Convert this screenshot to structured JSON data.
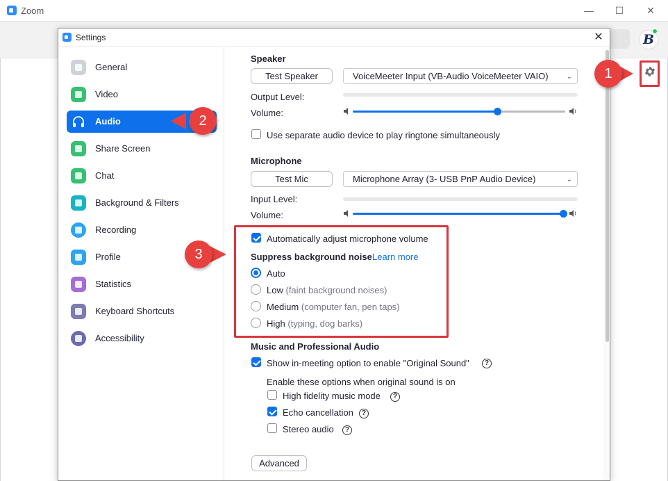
{
  "app": {
    "title": "Zoom",
    "minimize": "—",
    "maximize": "☐",
    "close": "✕",
    "avatar_letter": "B"
  },
  "callouts": [
    "1",
    "2",
    "3"
  ],
  "dialog": {
    "title": "Settings",
    "close": "✕"
  },
  "sidebar": {
    "items": [
      {
        "label": "General",
        "icon": "gear-icon",
        "color": "#cfd3d8"
      },
      {
        "label": "Video",
        "icon": "video-icon",
        "color": "#36c172"
      },
      {
        "label": "Audio",
        "icon": "headphones-icon",
        "color": "#0e71eb"
      },
      {
        "label": "Share Screen",
        "icon": "share-screen-icon",
        "color": "#36c172"
      },
      {
        "label": "Chat",
        "icon": "chat-icon",
        "color": "#36c172"
      },
      {
        "label": "Background & Filters",
        "icon": "background-icon",
        "color": "#19b4c4"
      },
      {
        "label": "Recording",
        "icon": "recording-icon",
        "color": "#2da4f2"
      },
      {
        "label": "Profile",
        "icon": "profile-icon",
        "color": "#2da4f2"
      },
      {
        "label": "Statistics",
        "icon": "statistics-icon",
        "color": "#a66dd4"
      },
      {
        "label": "Keyboard Shortcuts",
        "icon": "keyboard-icon",
        "color": "#7c7cb0"
      },
      {
        "label": "Accessibility",
        "icon": "accessibility-icon",
        "color": "#6b6bb0"
      }
    ],
    "active_index": 2
  },
  "speaker": {
    "title": "Speaker",
    "test_button": "Test Speaker",
    "device": "VoiceMeeter Input (VB-Audio VoiceMeeter VAIO)",
    "output_level_label": "Output Level:",
    "volume_label": "Volume:",
    "volume_fraction": 0.68,
    "ringtone_checkbox": "Use separate audio device to play ringtone simultaneously",
    "ringtone_checked": false
  },
  "microphone": {
    "title": "Microphone",
    "test_button": "Test Mic",
    "device": "Microphone Array (3- USB PnP Audio Device)",
    "input_level_label": "Input Level:",
    "volume_label": "Volume:",
    "volume_fraction": 0.99,
    "auto_adjust_label": "Automatically adjust microphone volume",
    "auto_adjust_checked": true
  },
  "noise": {
    "title": "Suppress background noise",
    "learn_more": "Learn more",
    "selected": "Auto",
    "options": [
      {
        "label": "Auto",
        "hint": ""
      },
      {
        "label": "Low",
        "hint": "(faint background noises)"
      },
      {
        "label": "Medium",
        "hint": "(computer fan, pen taps)"
      },
      {
        "label": "High",
        "hint": "(typing, dog barks)"
      }
    ]
  },
  "music": {
    "title": "Music and Professional Audio",
    "original_sound_label": "Show in-meeting option to enable \"Original Sound\"",
    "original_sound_checked": true,
    "sub_title": "Enable these options when original sound is on",
    "options": [
      {
        "label": "High fidelity music mode",
        "checked": false
      },
      {
        "label": "Echo cancellation",
        "checked": true
      },
      {
        "label": "Stereo audio",
        "checked": false
      }
    ],
    "help": "?"
  },
  "advanced_button": "Advanced",
  "colors": {
    "accent": "#0e71eb",
    "annotation_red": "#d9363e",
    "callout_red": "#e8403f"
  }
}
